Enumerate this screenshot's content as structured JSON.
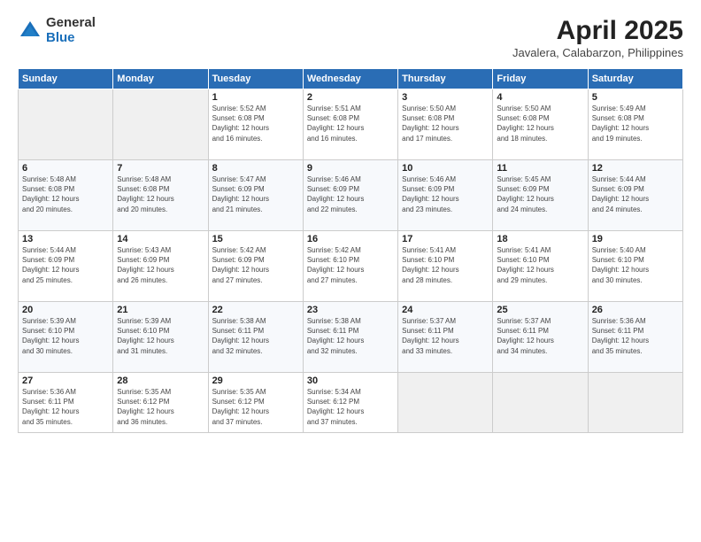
{
  "header": {
    "logo_general": "General",
    "logo_blue": "Blue",
    "month_title": "April 2025",
    "location": "Javalera, Calabarzon, Philippines"
  },
  "days_of_week": [
    "Sunday",
    "Monday",
    "Tuesday",
    "Wednesday",
    "Thursday",
    "Friday",
    "Saturday"
  ],
  "weeks": [
    [
      {
        "num": "",
        "info": ""
      },
      {
        "num": "",
        "info": ""
      },
      {
        "num": "1",
        "info": "Sunrise: 5:52 AM\nSunset: 6:08 PM\nDaylight: 12 hours\nand 16 minutes."
      },
      {
        "num": "2",
        "info": "Sunrise: 5:51 AM\nSunset: 6:08 PM\nDaylight: 12 hours\nand 16 minutes."
      },
      {
        "num": "3",
        "info": "Sunrise: 5:50 AM\nSunset: 6:08 PM\nDaylight: 12 hours\nand 17 minutes."
      },
      {
        "num": "4",
        "info": "Sunrise: 5:50 AM\nSunset: 6:08 PM\nDaylight: 12 hours\nand 18 minutes."
      },
      {
        "num": "5",
        "info": "Sunrise: 5:49 AM\nSunset: 6:08 PM\nDaylight: 12 hours\nand 19 minutes."
      }
    ],
    [
      {
        "num": "6",
        "info": "Sunrise: 5:48 AM\nSunset: 6:08 PM\nDaylight: 12 hours\nand 20 minutes."
      },
      {
        "num": "7",
        "info": "Sunrise: 5:48 AM\nSunset: 6:08 PM\nDaylight: 12 hours\nand 20 minutes."
      },
      {
        "num": "8",
        "info": "Sunrise: 5:47 AM\nSunset: 6:09 PM\nDaylight: 12 hours\nand 21 minutes."
      },
      {
        "num": "9",
        "info": "Sunrise: 5:46 AM\nSunset: 6:09 PM\nDaylight: 12 hours\nand 22 minutes."
      },
      {
        "num": "10",
        "info": "Sunrise: 5:46 AM\nSunset: 6:09 PM\nDaylight: 12 hours\nand 23 minutes."
      },
      {
        "num": "11",
        "info": "Sunrise: 5:45 AM\nSunset: 6:09 PM\nDaylight: 12 hours\nand 24 minutes."
      },
      {
        "num": "12",
        "info": "Sunrise: 5:44 AM\nSunset: 6:09 PM\nDaylight: 12 hours\nand 24 minutes."
      }
    ],
    [
      {
        "num": "13",
        "info": "Sunrise: 5:44 AM\nSunset: 6:09 PM\nDaylight: 12 hours\nand 25 minutes."
      },
      {
        "num": "14",
        "info": "Sunrise: 5:43 AM\nSunset: 6:09 PM\nDaylight: 12 hours\nand 26 minutes."
      },
      {
        "num": "15",
        "info": "Sunrise: 5:42 AM\nSunset: 6:09 PM\nDaylight: 12 hours\nand 27 minutes."
      },
      {
        "num": "16",
        "info": "Sunrise: 5:42 AM\nSunset: 6:10 PM\nDaylight: 12 hours\nand 27 minutes."
      },
      {
        "num": "17",
        "info": "Sunrise: 5:41 AM\nSunset: 6:10 PM\nDaylight: 12 hours\nand 28 minutes."
      },
      {
        "num": "18",
        "info": "Sunrise: 5:41 AM\nSunset: 6:10 PM\nDaylight: 12 hours\nand 29 minutes."
      },
      {
        "num": "19",
        "info": "Sunrise: 5:40 AM\nSunset: 6:10 PM\nDaylight: 12 hours\nand 30 minutes."
      }
    ],
    [
      {
        "num": "20",
        "info": "Sunrise: 5:39 AM\nSunset: 6:10 PM\nDaylight: 12 hours\nand 30 minutes."
      },
      {
        "num": "21",
        "info": "Sunrise: 5:39 AM\nSunset: 6:10 PM\nDaylight: 12 hours\nand 31 minutes."
      },
      {
        "num": "22",
        "info": "Sunrise: 5:38 AM\nSunset: 6:11 PM\nDaylight: 12 hours\nand 32 minutes."
      },
      {
        "num": "23",
        "info": "Sunrise: 5:38 AM\nSunset: 6:11 PM\nDaylight: 12 hours\nand 32 minutes."
      },
      {
        "num": "24",
        "info": "Sunrise: 5:37 AM\nSunset: 6:11 PM\nDaylight: 12 hours\nand 33 minutes."
      },
      {
        "num": "25",
        "info": "Sunrise: 5:37 AM\nSunset: 6:11 PM\nDaylight: 12 hours\nand 34 minutes."
      },
      {
        "num": "26",
        "info": "Sunrise: 5:36 AM\nSunset: 6:11 PM\nDaylight: 12 hours\nand 35 minutes."
      }
    ],
    [
      {
        "num": "27",
        "info": "Sunrise: 5:36 AM\nSunset: 6:11 PM\nDaylight: 12 hours\nand 35 minutes."
      },
      {
        "num": "28",
        "info": "Sunrise: 5:35 AM\nSunset: 6:12 PM\nDaylight: 12 hours\nand 36 minutes."
      },
      {
        "num": "29",
        "info": "Sunrise: 5:35 AM\nSunset: 6:12 PM\nDaylight: 12 hours\nand 37 minutes."
      },
      {
        "num": "30",
        "info": "Sunrise: 5:34 AM\nSunset: 6:12 PM\nDaylight: 12 hours\nand 37 minutes."
      },
      {
        "num": "",
        "info": ""
      },
      {
        "num": "",
        "info": ""
      },
      {
        "num": "",
        "info": ""
      }
    ]
  ]
}
